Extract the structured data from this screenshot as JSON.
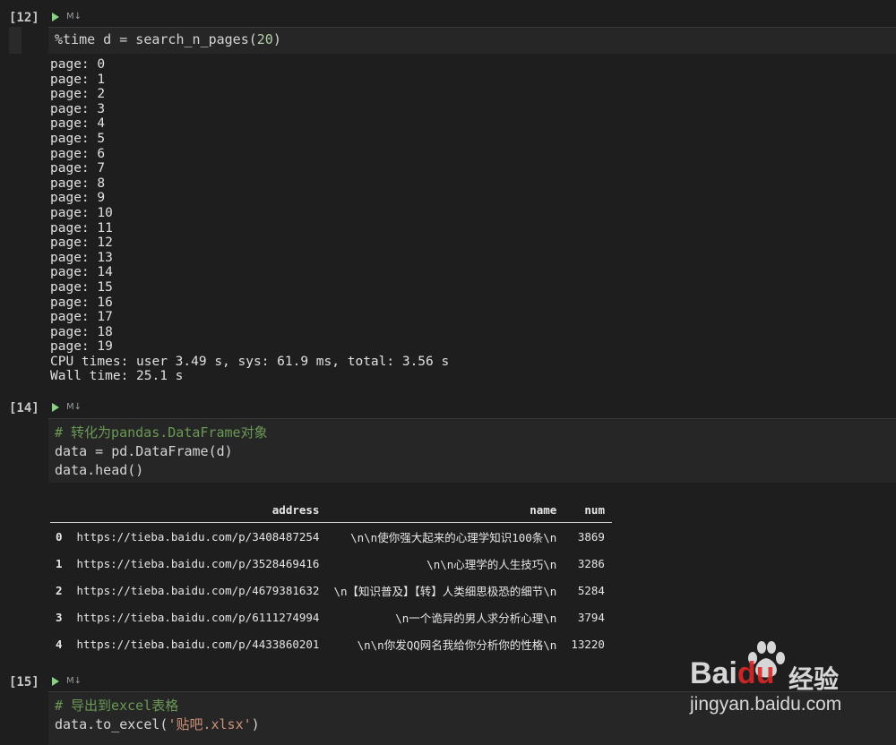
{
  "cells": [
    {
      "prompt": "[12]",
      "badge": "M↓",
      "code": [
        "%time d = search_n_pages(20)"
      ],
      "output": [
        "page: 0",
        "page: 1",
        "page: 2",
        "page: 3",
        "page: 4",
        "page: 5",
        "page: 6",
        "page: 7",
        "page: 8",
        "page: 9",
        "page: 10",
        "page: 11",
        "page: 12",
        "page: 13",
        "page: 14",
        "page: 15",
        "page: 16",
        "page: 17",
        "page: 18",
        "page: 19",
        "CPU times: user 3.49 s, sys: 61.9 ms, total: 3.56 s",
        "Wall time: 25.1 s"
      ]
    },
    {
      "prompt": "[14]",
      "badge": "M↓",
      "code": [
        "# 转化为pandas.DataFrame对象",
        "data = pd.DataFrame(d)",
        "data.head()"
      ],
      "table": {
        "columns": [
          "",
          "address",
          "name",
          "num"
        ],
        "rows": [
          [
            "0",
            "https://tieba.baidu.com/p/3408487254",
            "\\n\\n使你强大起来的心理学知识100条\\n",
            "3869"
          ],
          [
            "1",
            "https://tieba.baidu.com/p/3528469416",
            "\\n\\n心理学的人生技巧\\n",
            "3286"
          ],
          [
            "2",
            "https://tieba.baidu.com/p/4679381632",
            "\\n【知识普及】【转】人类细思极恐的细节\\n",
            "5284"
          ],
          [
            "3",
            "https://tieba.baidu.com/p/6111274994",
            "\\n一个诡异的男人求分析心理\\n",
            "3794"
          ],
          [
            "4",
            "https://tieba.baidu.com/p/4433860201",
            "\\n\\n你发QQ网名我给你分析你的性格\\n",
            "13220"
          ]
        ]
      }
    },
    {
      "prompt": "[15]",
      "badge": "M↓",
      "code": [
        "# 导出到excel表格",
        "data.to_excel('贴吧.xlsx')"
      ]
    }
  ],
  "watermark": {
    "brand": "Bai",
    "brand2": "du",
    "cn": "经验",
    "url": "jingyan.baidu.com"
  },
  "colors": {
    "run": "#89d185",
    "comment": "#6a9955",
    "string": "#ce9178",
    "number": "#b5cea8"
  }
}
